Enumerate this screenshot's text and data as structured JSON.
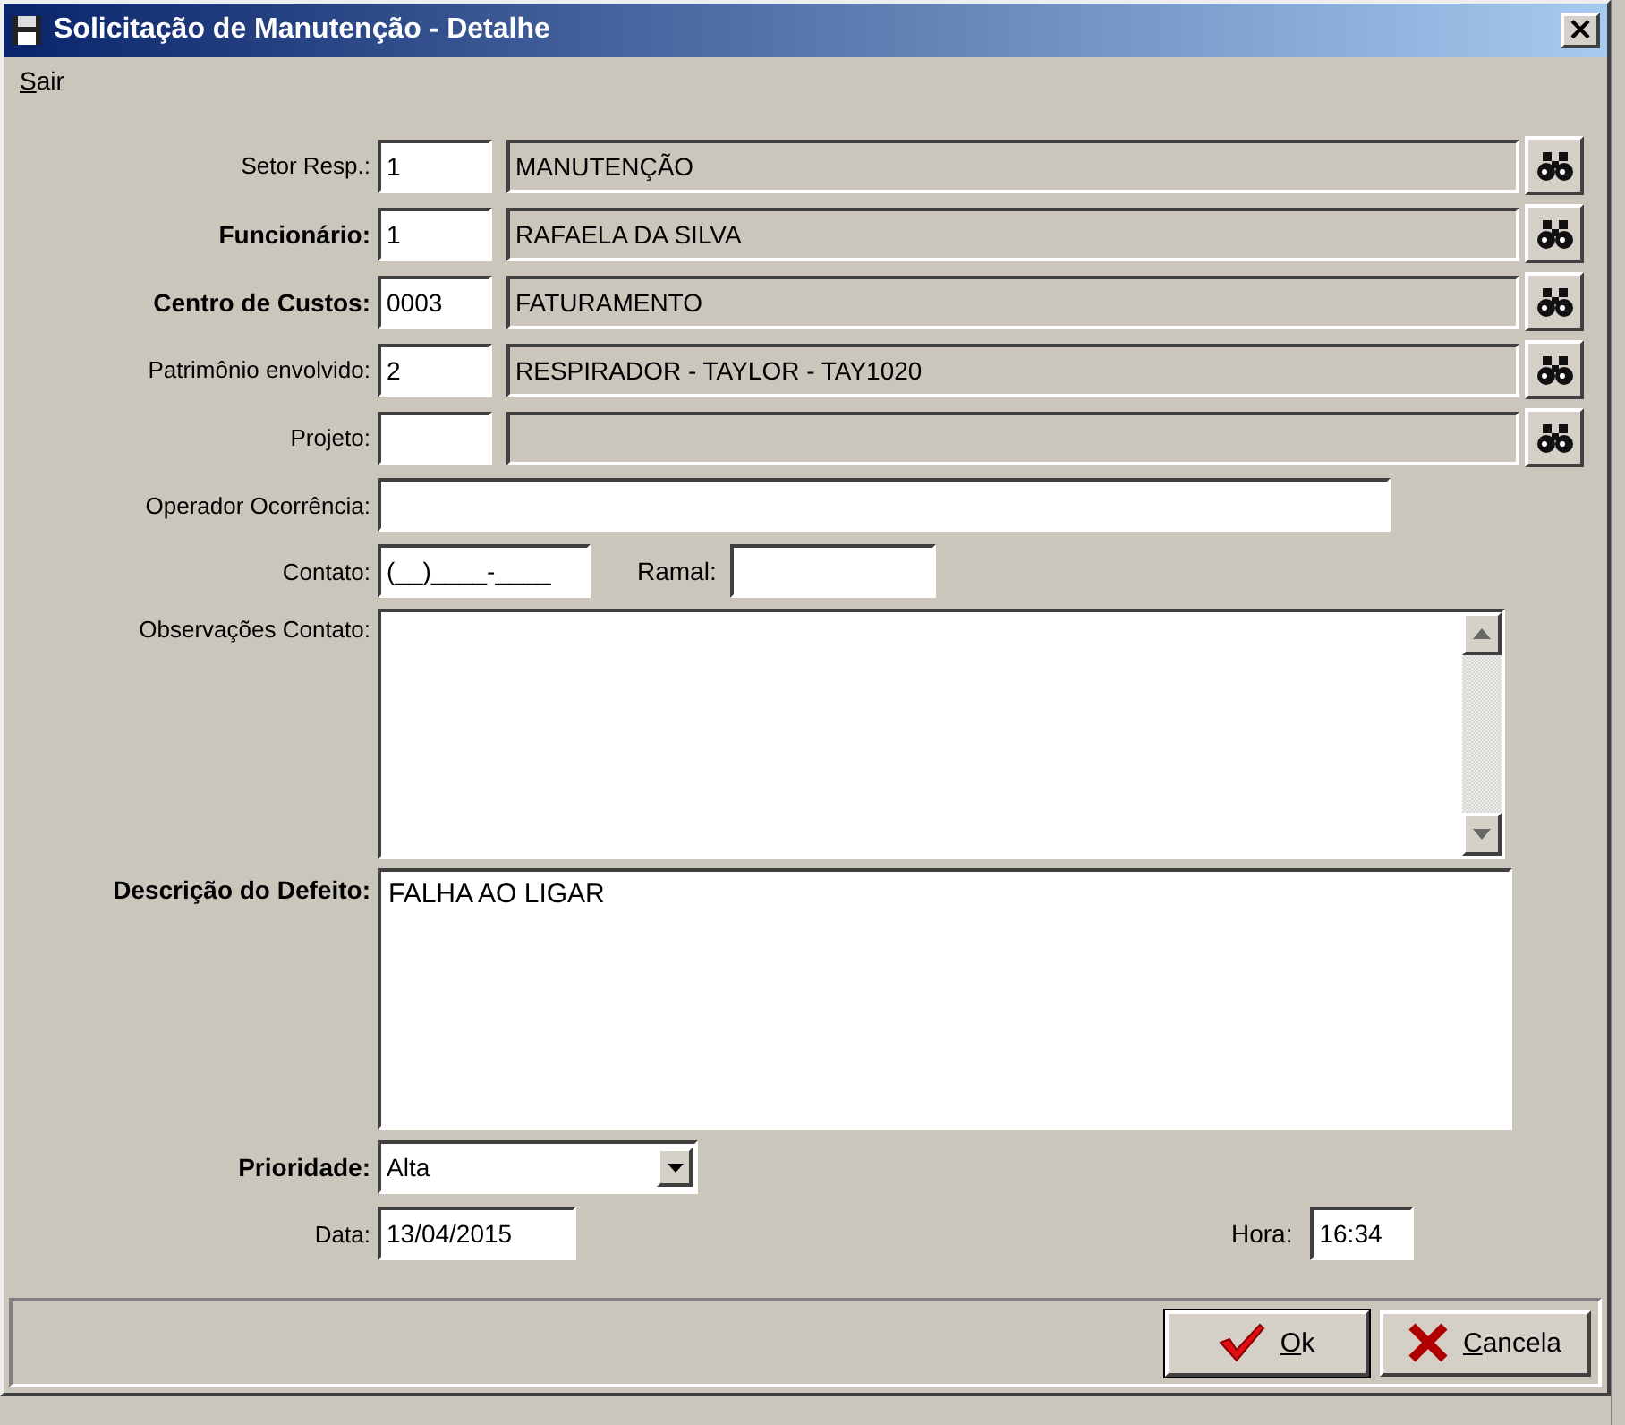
{
  "window": {
    "title": "Solicitação de Manutenção - Detalhe",
    "close": "×"
  },
  "menu": [
    {
      "label": "Sair"
    }
  ],
  "lookups": [
    {
      "label": "Setor Resp.:",
      "required": false,
      "code": "1",
      "name": "MANUTENÇÃO"
    },
    {
      "label": "Funcionário:",
      "required": true,
      "code": "1",
      "name": "RAFAELA DA SILVA"
    },
    {
      "label": "Centro de Custos:",
      "required": true,
      "code": "0003",
      "name": "FATURAMENTO"
    },
    {
      "label": "Patrimônio envolvido:",
      "required": false,
      "code": "2",
      "name": "RESPIRADOR - TAYLOR - TAY1020"
    },
    {
      "label": "Projeto:",
      "required": false
    }
  ],
  "operador": {
    "label": "Operador Ocorrência:"
  },
  "contato": {
    "label": "Contato:",
    "value": "(__)____-____"
  },
  "ramal": {
    "label": "Ramal:"
  },
  "observacoes": {
    "label": "Observações Contato:"
  },
  "descricao": {
    "label": "Descrição do Defeito:",
    "required": true,
    "value": "FALHA AO LIGAR"
  },
  "prioridade": {
    "label": "Prioridade:",
    "required": true,
    "value": "Alta"
  },
  "data": {
    "label": "Data:",
    "value": "13/04/2015"
  },
  "hora": {
    "label": "Hora:",
    "value": "16:34"
  },
  "buttons": [
    {
      "kind": "ok",
      "label": "Ok",
      "focused": true
    },
    {
      "kind": "cancel",
      "label": "Cancela",
      "focused": false
    }
  ]
}
